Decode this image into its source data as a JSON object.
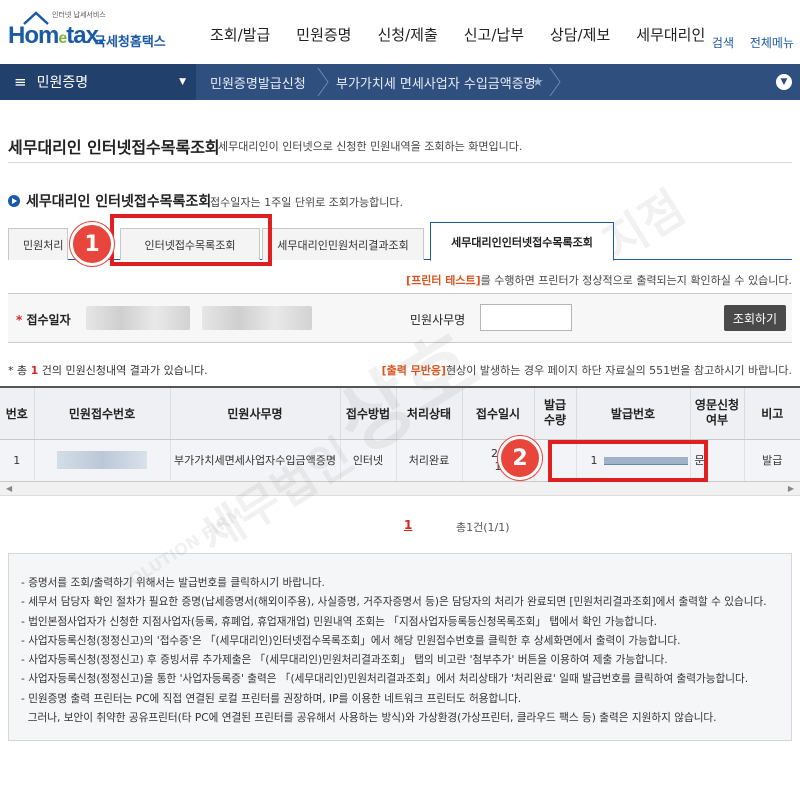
{
  "header": {
    "logo_small": "인터넷 납세서비스",
    "logo_main": "Hom",
    "logo_e": "e",
    "logo_rest": "tax.",
    "logo_sub": "국세청홈택스",
    "nav": [
      "조회/발급",
      "민원증명",
      "신청/제출",
      "신고/납부",
      "상담/제보",
      "세무대리인"
    ],
    "util": [
      "검색",
      "전체메뉴"
    ]
  },
  "breadcrumb": {
    "menu": "민원증명",
    "items": [
      "민원증명발급신청",
      "부가가치세 면세사업자 수입금액증명"
    ],
    "star": "★",
    "right_icon": "chevron-down-icon"
  },
  "page": {
    "title": "세무대리인 인터넷접수목록조회",
    "desc": "세무대리인이 인터넷으로 신청한 민원내역을 조회하는 화면입니다.",
    "section_title": "세무대리인 인터넷접수목록조회",
    "section_note": "접수일자는 1주일 단위로 조회가능합니다."
  },
  "tabs": [
    {
      "label": "민원처리"
    },
    {
      "label": "인터넷접수목록조회"
    },
    {
      "label": "세무대리인민원처리결과조회"
    },
    {
      "label": "세무대리인인터넷접수목록조회"
    }
  ],
  "annotations": {
    "badge1": "1",
    "badge2": "2"
  },
  "printer_note": {
    "hl": "[프린터 테스트]",
    "text": "를 수행하면 프린터가 정상적으로 출력되는지 확인하실 수 있습니다."
  },
  "search": {
    "date_label": "접수일자",
    "required_mark": "*",
    "petition_label": "민원사무명",
    "petition_value": "",
    "button": "조회하기"
  },
  "results": {
    "prefix": "* 총 ",
    "count": "1",
    "suffix": " 건의 민원신청내역 결과가 있습니다."
  },
  "output_note": {
    "hl": "[출력 무반응]",
    "text": "현상이 발생하는 경우 페이지 하단 자료실의 551번을 참고하시기 바랍니다."
  },
  "table": {
    "headers": [
      "번호",
      "민원접수번호",
      "민원사무명",
      "접수방법",
      "처리상태",
      "접수일시",
      "발급\n수량",
      "발급번호",
      "영문신청\n여부",
      "비고"
    ],
    "rows": [
      {
        "no": "1",
        "petition": "부가가치세면세사업자수입금액증명",
        "method": "인터넷",
        "status": "처리완료",
        "date1": "20",
        "date2": "1",
        "qty": "1",
        "eng": "문",
        "note": "발급"
      }
    ]
  },
  "pager": {
    "page": "1",
    "total": "총1건(1/1)"
  },
  "info": [
    "- 증명서를 조회/출력하기 위해서는 발급번호를 클릭하시기 바랍니다.",
    "- 세무서 담당자 확인 절차가 필요한 증명(납세증명서(해외이주용), 사실증명, 거주자증명서 등)은 담당자의 처리가 완료되면 [민원처리결과조회]에서 출력할 수 있습니다.",
    "- 법인본점사업자가 신청한 지점사업자(등록, 휴폐업, 휴업재개업) 민원내역 조회는 「지점사업자등록등신청목록조회」 탭에서 확인 가능합니다.",
    "- 사업자등록신청(정정신고)의 '접수증'은 「(세무대리인)인터넷접수목록조회」에서 해당 민원접수번호를 클릭한 후 상세화면에서 출력이 가능합니다.",
    "- 사업자등록신청(정정신고) 후 증빙서류 추가제출은 「(세무대리인)민원처리결과조회」 탭의 비고란 '첨부추가' 버튼을 이용하여 제출 가능합니다.",
    "- 사업자등록신청(정정신고)을 통한 '사업자등록증' 출력은 「(세무대리인)민원처리결과조회」에서 처리상태가 '처리완료' 일때 발급번호를 클릭하여 출력가능합니다.",
    "- 민원증명 출력 프린터는 PC에 직접 연결된 로컬 프린터를 권장하며, IP를 이용한 네트워크 프린터도 허용합니다.",
    "  그러나, 보안이 취약한 공유프린터(타 PC에 연결된 프린터를 공유해서 사용하는 방식)와 가상환경(가상프린터, 클라우드 팩스 등) 출력은 지원하지 않습니다."
  ],
  "watermark": [
    "상호",
    "세무법인",
    "지점",
    "SOLUTION FIRM"
  ],
  "colors": {
    "brand": "#1b5aa6",
    "nav_bar": "#2f4f7f",
    "highlight": "#e02020"
  }
}
